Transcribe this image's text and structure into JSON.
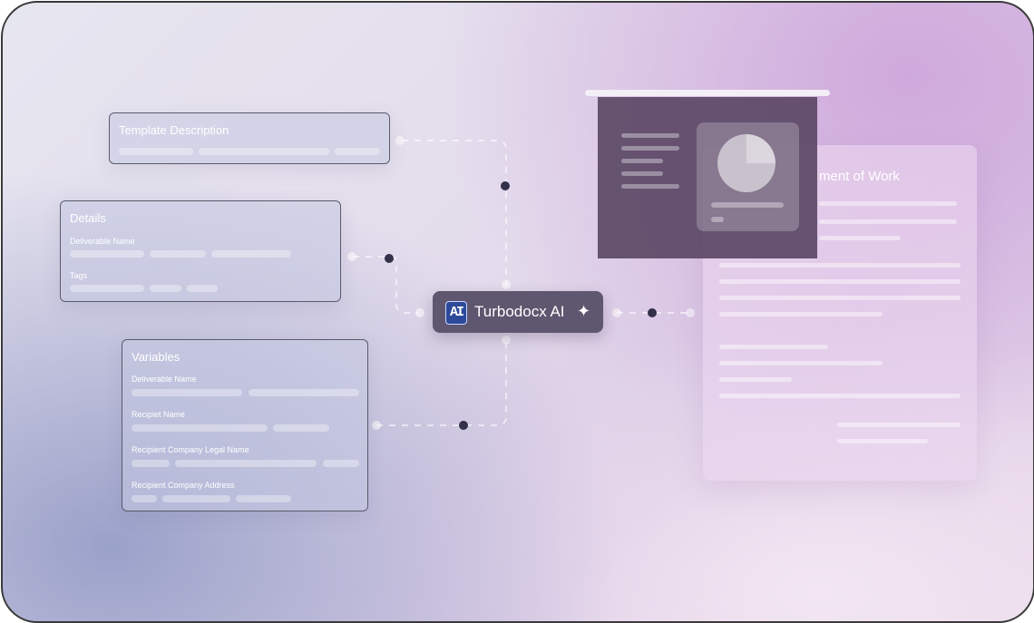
{
  "template_description": {
    "title": "Template Description"
  },
  "details": {
    "title": "Details",
    "fields": [
      {
        "label": "Deliverable Name"
      },
      {
        "label": "Tags"
      }
    ]
  },
  "variables": {
    "title": "Variables",
    "fields": [
      {
        "label": "Deliverable Name"
      },
      {
        "label": "Recipiet Name"
      },
      {
        "label": "Recipient Company Legal Name"
      },
      {
        "label": "Recipient Company Address"
      }
    ]
  },
  "ai_node": {
    "logo_text": "AI",
    "name": "Turbodocx AI",
    "icon": "sparkle-icon"
  },
  "output_document": {
    "title_visible": "ment of Work"
  },
  "presentation": {
    "icon": "pie-chart-icon",
    "pie_fraction": 0.25
  },
  "colors": {
    "ai_pill": "#5f566f",
    "node_dot": "#33304a",
    "logo": "#2d4a9a"
  }
}
